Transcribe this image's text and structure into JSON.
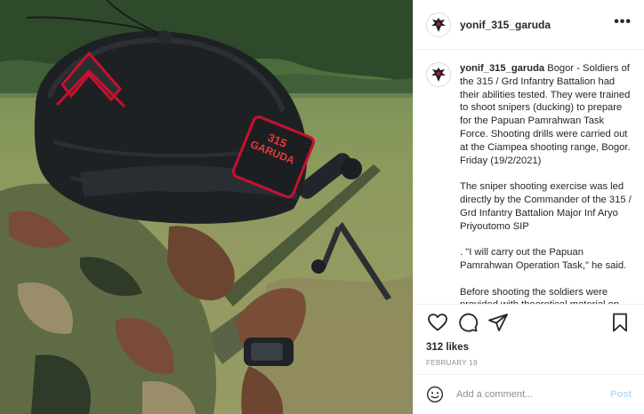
{
  "post": {
    "photo": {
      "patch_text_line1": "315",
      "patch_text_line2": "GARUDA"
    },
    "header": {
      "username": "yonif_315_garuda",
      "more_label": "•••"
    },
    "caption": {
      "username": "yonif_315_garuda",
      "paragraphs": [
        "Bogor - Soldiers of the 315 / Grd Infantry Battalion had their abilities tested. They were trained to shoot snipers (ducking) to prepare for the Papuan Pamrahwan Task Force. Shooting drills were carried out at the Ciampea shooting range, Bogor. Friday (19/2/2021)",
        "The sniper shooting exercise was led directly by the Commander of the 315 / Grd Infantry Battalion Major Inf Aryo Priyoutomo SIP",
        ". \"I will carry out the Papuan Pamrahwan Operation Task,\" he said.",
        "Before shooting the soldiers were provided with theoretical material on how to make camouflage or disguise"
      ]
    },
    "actions": {
      "icons": [
        "heart-icon",
        "comment-icon",
        "share-icon",
        "bookmark-icon"
      ]
    },
    "likes_text": "312 likes",
    "date_text": "FEBRUARY 19",
    "comment": {
      "placeholder": "Add a comment...",
      "post_label": "Post"
    },
    "colors": {
      "text": "#262626",
      "muted": "#8e8e8e",
      "border": "#efefef",
      "post_disabled": "#b3dbff",
      "patch_red": "#c8102e"
    }
  }
}
